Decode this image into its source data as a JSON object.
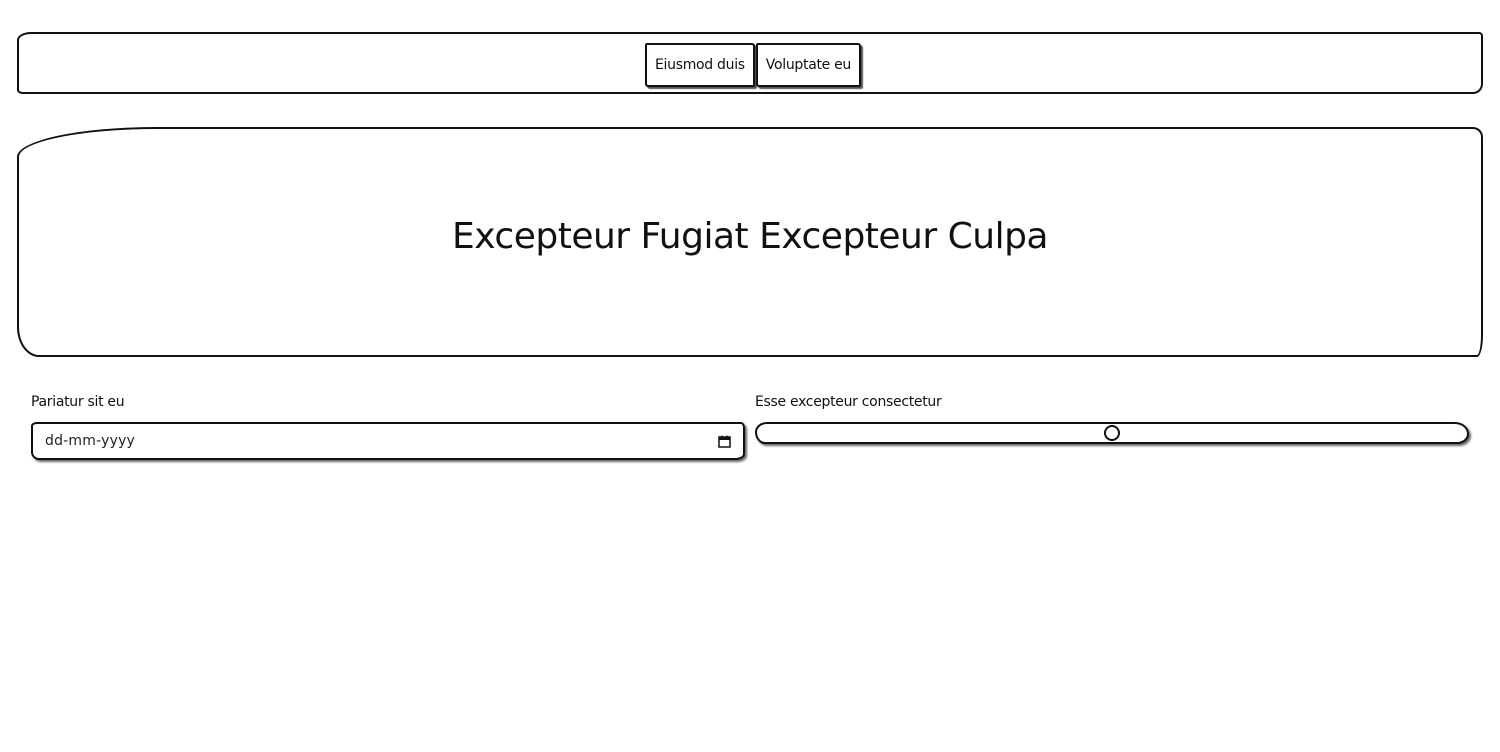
{
  "nav": {
    "buttons": [
      {
        "label": "Eiusmod duis"
      },
      {
        "label": "Voluptate eu"
      }
    ]
  },
  "hero": {
    "title": "Excepteur Fugiat Excepteur Culpa"
  },
  "form": {
    "date_field": {
      "label": "Pariatur sit eu",
      "placeholder": "dd-mm-yyyy",
      "icon": "calendar-icon"
    },
    "range_field": {
      "label": "Esse excepteur consectetur",
      "value_fraction": 0.5
    }
  },
  "colors": {
    "stroke": "#111111",
    "background": "#ffffff"
  }
}
